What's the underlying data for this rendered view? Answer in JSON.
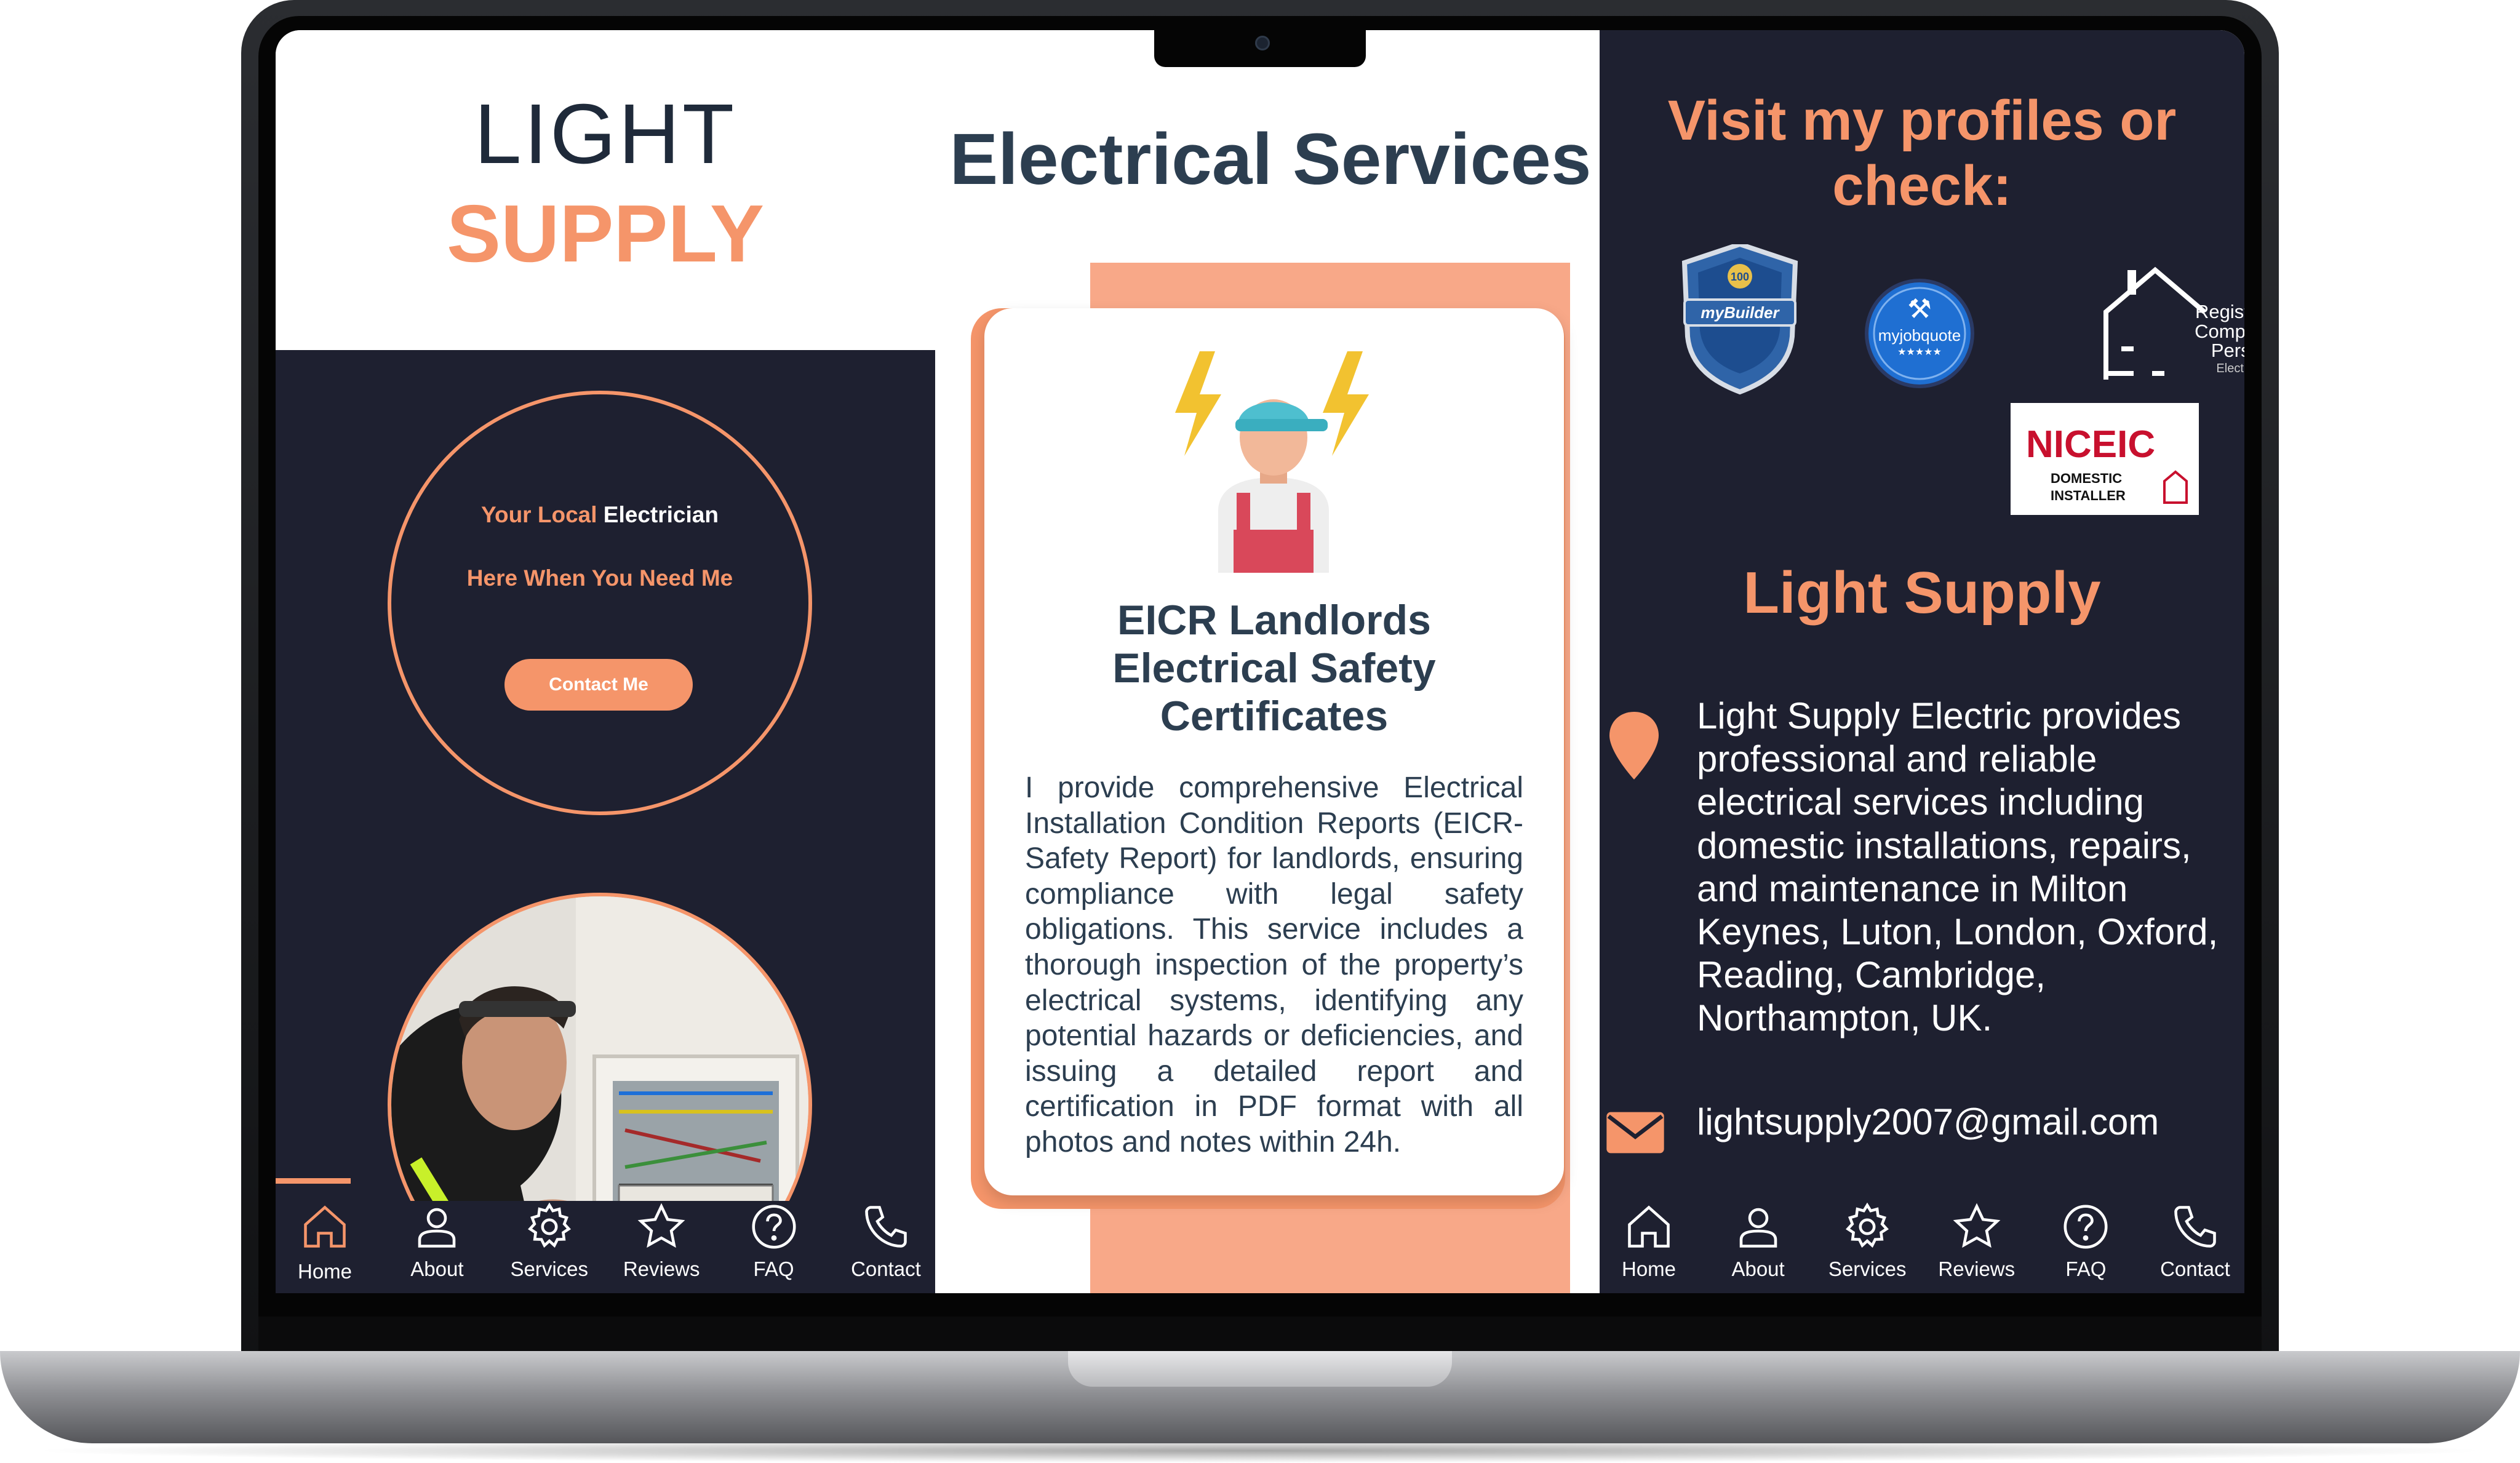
{
  "logo": {
    "light": "LIGHT",
    "supply": "SUPPLY"
  },
  "hero": {
    "tagline_accent": "Your Local",
    "tagline_white": "Electrician",
    "tagline_line2": "Here When You Need Me",
    "contact_button": "Contact Me"
  },
  "nav": {
    "items": [
      {
        "label": "Home",
        "icon": "home-icon"
      },
      {
        "label": "About",
        "icon": "user-icon"
      },
      {
        "label": "Services",
        "icon": "gear-icon"
      },
      {
        "label": "Reviews",
        "icon": "star-icon"
      },
      {
        "label": "FAQ",
        "icon": "question-icon"
      },
      {
        "label": "Contact",
        "icon": "phone-icon"
      }
    ],
    "active": "Home"
  },
  "services": {
    "page_title": "Electrical Services",
    "card_title": "EICR Landlords Electrical Safety Certificates",
    "card_body": "I provide comprehensive Electrical Installation Condition Reports (EICR-Safety Report) for landlords, ensuring compliance with legal safety obligations. This service includes a thorough inspection of the property’s electrical systems, identifying any potential hazards or deficiencies, and issuing a detailed report and certification in PDF format with all photos and notes within 24h."
  },
  "profiles": {
    "title": "Visit my profiles or check:",
    "badges": {
      "mybuilder": "myBuilder",
      "mybuilder_score": "100",
      "myjobquote": "myjobquote",
      "rcp_line1": "Registered",
      "rcp_line2": "Competent",
      "rcp_line3": "Person",
      "rcp_line4": "Electrical",
      "niceic_logo": "NICEIC",
      "niceic_line1": "DOMESTIC",
      "niceic_line2": "INSTALLER"
    }
  },
  "about": {
    "brand": "Light Supply",
    "description": "Light Supply Electric provides professional and reliable electrical services including domestic installations, repairs, and maintenance in Milton Keynes, Luton, London, Oxford, Reading, Cambridge, Northampton, UK.",
    "email": "lightsupply2007@gmail.com"
  },
  "colors": {
    "accent": "#f5956a",
    "dark": "#1e2030",
    "navy": "#2c3e50",
    "strip": "#f8a888"
  }
}
